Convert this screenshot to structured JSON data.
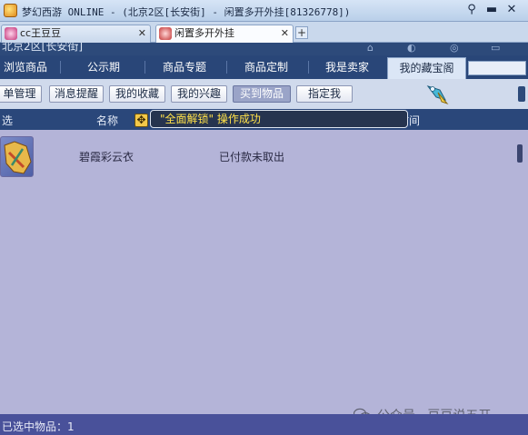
{
  "window": {
    "title": "梦幻西游 ONLINE - (北京2区[长安街] - 闲置多开外挂[81326778])"
  },
  "browser_tabs": [
    {
      "label": "cc王豆豆"
    },
    {
      "label": "闲置多开外挂"
    }
  ],
  "header": {
    "region": "北京2区[长安街]"
  },
  "nav": {
    "items": [
      {
        "label": "浏览商品"
      },
      {
        "label": "公示期"
      },
      {
        "label": "商品专题"
      },
      {
        "label": "商品定制"
      },
      {
        "label": "我是卖家"
      },
      {
        "label": "我的藏宝阁"
      }
    ]
  },
  "subnav": {
    "items": [
      {
        "label": "单管理"
      },
      {
        "label": "消息提醒"
      },
      {
        "label": "我的收藏"
      },
      {
        "label": "我的兴趣"
      },
      {
        "label": "买到物品"
      },
      {
        "label": "指定我"
      }
    ]
  },
  "table": {
    "columns": [
      "选",
      "名称",
      "剩余时间"
    ],
    "rows": [
      {
        "name": "碧霞彩云衣",
        "status": "已付款未取出"
      }
    ]
  },
  "toast": {
    "message": "\"全面解锁\" 操作成功"
  },
  "watermark": {
    "text": "公众号 · 豆豆说五开"
  },
  "status": {
    "selected_count_text": "已选中物品：1"
  },
  "colors": {
    "nav_bg": "#294678",
    "content_bg": "#b4b4d8",
    "toast_text": "#ffe14a",
    "status_bg": "#49519a"
  },
  "icons": [
    "app-icon",
    "pin-icon",
    "minimize-icon",
    "close-icon",
    "tab-close-icon",
    "new-tab-icon",
    "move-icon",
    "item-thumbnail",
    "mascot-icon",
    "wechat-icon"
  ]
}
